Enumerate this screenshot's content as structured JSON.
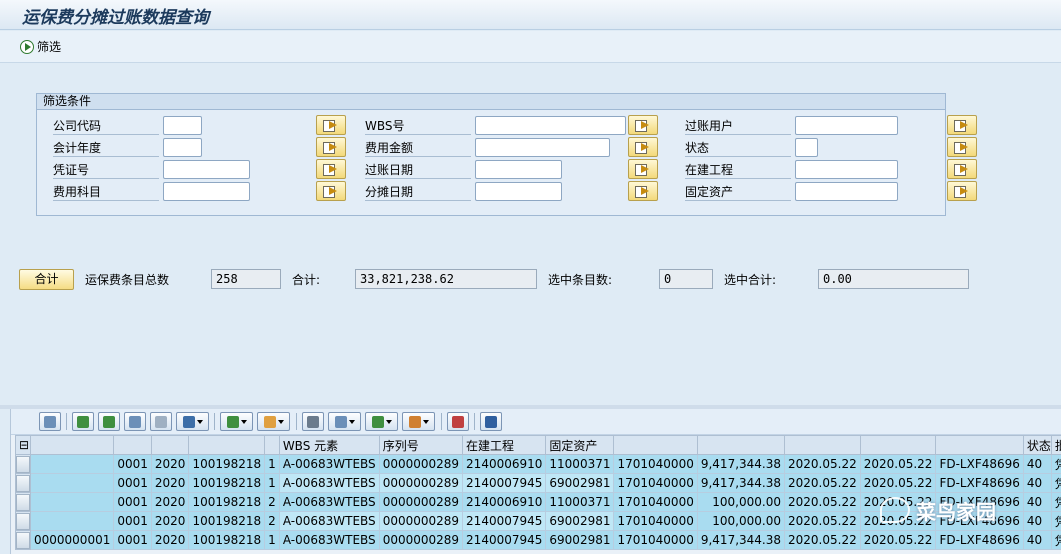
{
  "window": {
    "title": "运保费分摊过账数据查询"
  },
  "toolbar": {
    "filter_label": "筛选"
  },
  "filter_group": {
    "title": "筛选条件",
    "col1": [
      {
        "label": "公司代码",
        "value": ""
      },
      {
        "label": "会计年度",
        "value": ""
      },
      {
        "label": "凭证号",
        "value": ""
      },
      {
        "label": "费用科目",
        "value": ""
      }
    ],
    "col2": [
      {
        "label": "WBS号",
        "value": ""
      },
      {
        "label": "费用金额",
        "value": ""
      },
      {
        "label": "过账日期",
        "value": ""
      },
      {
        "label": "分摊日期",
        "value": ""
      }
    ],
    "col3": [
      {
        "label": "过账用户",
        "value": ""
      },
      {
        "label": "状态",
        "value": ""
      },
      {
        "label": "在建工程",
        "value": ""
      },
      {
        "label": "固定资产",
        "value": ""
      }
    ]
  },
  "summary": {
    "sum_button": "合计",
    "total_count_label": "运保费条目总数",
    "total_count": "258",
    "total_label": "合计:",
    "total_value": "33,821,238.62",
    "selected_count_label": "选中条目数:",
    "selected_count": "0",
    "selected_total_label": "选中合计:",
    "selected_total": "0.00"
  },
  "grid": {
    "headers": [
      "",
      "",
      "",
      "",
      "",
      "WBS 元素",
      "序列号",
      "在建工程",
      "固定资产",
      "",
      "",
      "",
      "",
      "",
      "状态",
      "批"
    ],
    "rows": [
      [
        "",
        "0001",
        "2020",
        "100198218",
        "1",
        "A-00683WTEBS",
        "0000000289",
        "2140006910",
        "11000371",
        "1701040000",
        "9,417,344.38",
        "2020.05.22",
        "2020.05.22",
        "FD-LXF48696",
        "40",
        "凭"
      ],
      [
        "",
        "0001",
        "2020",
        "100198218",
        "1",
        "A-00683WTEBS",
        "0000000289",
        "2140007945",
        "69002981",
        "1701040000",
        "9,417,344.38",
        "2020.05.22",
        "2020.05.22",
        "FD-LXF48696",
        "40",
        "凭"
      ],
      [
        "",
        "0001",
        "2020",
        "100198218",
        "2",
        "A-00683WTEBS",
        "0000000289",
        "2140006910",
        "11000371",
        "1701040000",
        "100,000.00",
        "2020.05.22",
        "2020.05.22",
        "FD-LXF48696",
        "40",
        "凭"
      ],
      [
        "",
        "0001",
        "2020",
        "100198218",
        "2",
        "A-00683WTEBS",
        "0000000289",
        "2140007945",
        "69002981",
        "1701040000",
        "100,000.00",
        "2020.05.22",
        "2020.05.22",
        "FD-LXF48696",
        "40",
        "凭"
      ],
      [
        "0000000001",
        "0001",
        "2020",
        "100198218",
        "1",
        "A-00683WTEBS",
        "0000000289",
        "2140007945",
        "69002981",
        "1701040000",
        "9,417,344.38",
        "2020.05.22",
        "2020.05.22",
        "FD-LXF48696",
        "40",
        "凭"
      ]
    ]
  },
  "watermark": {
    "text": "菜鸟家园"
  }
}
